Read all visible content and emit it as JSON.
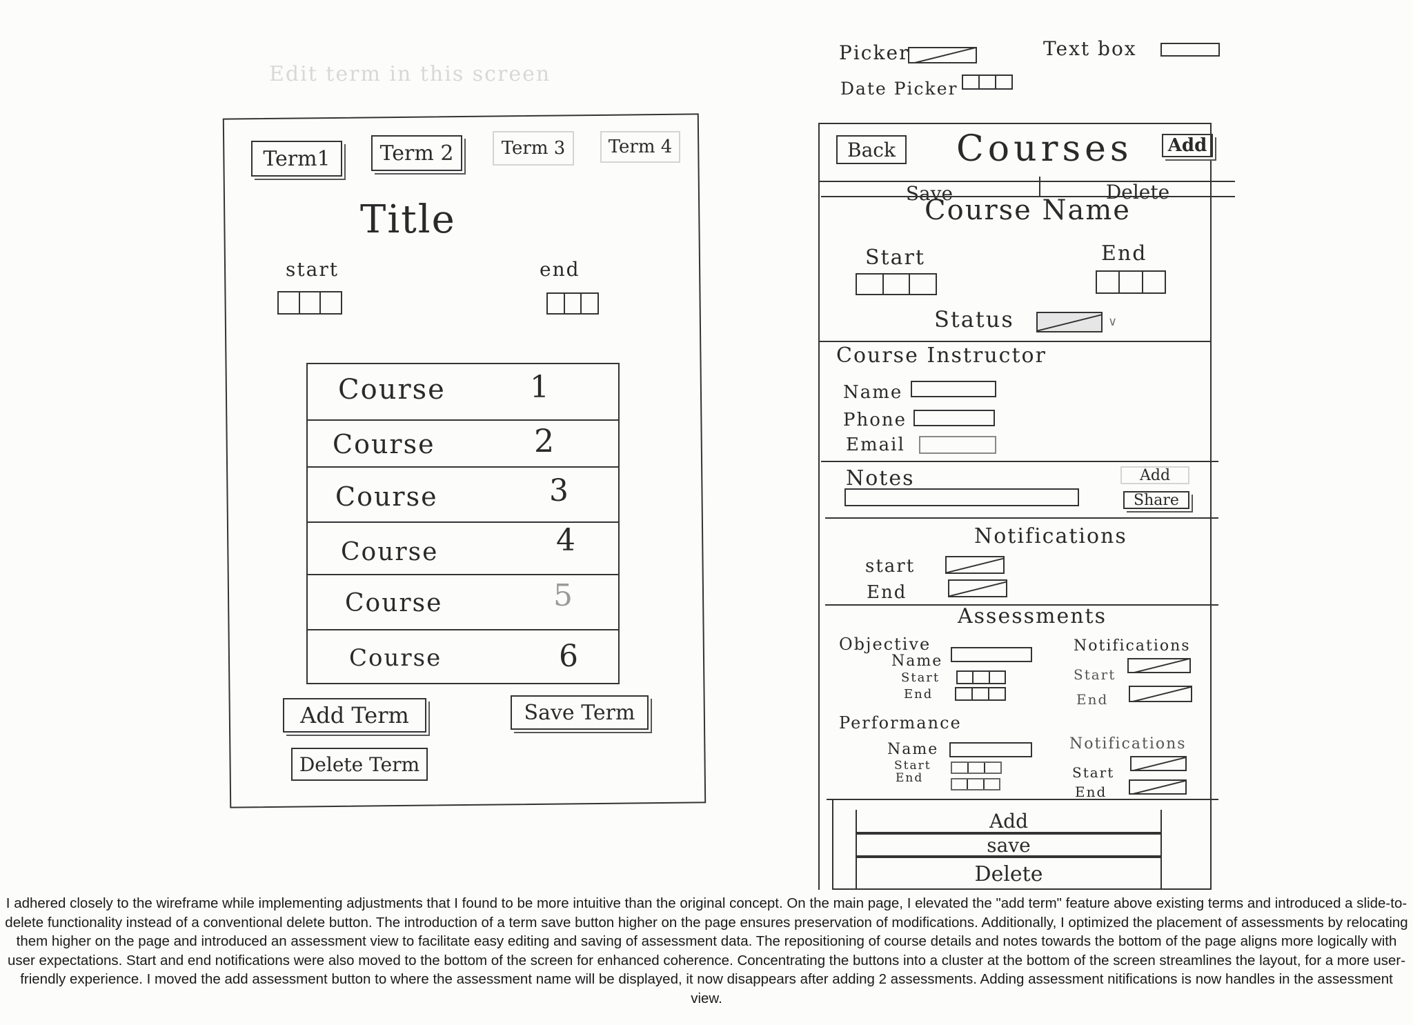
{
  "legend": {
    "picker": "Picker",
    "text_box": "Text box",
    "date_picker": "Date Picker"
  },
  "faint_label": "Edit term in this screen",
  "term_screen": {
    "tabs": [
      "Term1",
      "Term 2",
      "Term 3",
      "Term 4"
    ],
    "title": "Title",
    "start_label": "start",
    "end_label": "end",
    "courses": [
      {
        "label": "Course",
        "num": "1"
      },
      {
        "label": "Course",
        "num": "2"
      },
      {
        "label": "Course",
        "num": "3"
      },
      {
        "label": "Course",
        "num": "4"
      },
      {
        "label": "Course",
        "num": "5"
      },
      {
        "label": "Course",
        "num": "6"
      }
    ],
    "add_term": "Add Term",
    "save_term": "Save Term",
    "delete_term": "Delete Term"
  },
  "course_screen": {
    "back": "Back",
    "title": "Courses",
    "add": "Add",
    "save": "Save",
    "delete": "Delete",
    "course_name": "Course Name",
    "start_label": "Start",
    "end_label": "End",
    "status_label": "Status",
    "instructor_heading": "Course Instructor",
    "name_label": "Name",
    "phone_label": "Phone",
    "email_label": "Email",
    "notes_label": "Notes",
    "notes_add": "Add",
    "notes_share": "Share",
    "notifications_heading": "Notifications",
    "notif_start": "start",
    "notif_end": "End",
    "assessments_heading": "Assessments",
    "objective_label": "Objective",
    "performance_label": "Performance",
    "a_name": "Name",
    "a_start": "Start",
    "a_end": "End",
    "a_notifications": "Notifications",
    "bottom_add": "Add",
    "bottom_save": "save",
    "bottom_delete": "Delete"
  },
  "caption": "I adhered closely to the wireframe while implementing adjustments that I found to be more intuitive than the original concept. On the main page, I elevated the \"add term\" feature above existing terms and introduced a slide-to-delete functionality instead of a conventional delete button. The introduction of a term save button higher on the page ensures preservation of modifications. Additionally, I optimized the placement of assessments by relocating them higher on the page and introduced an assessment view to facilitate easy editing and saving of assessment data. The repositioning of course details and notes towards the bottom of the page aligns more logically with user expectations. Start and end notifications were also moved to the bottom of the screen for enhanced coherence. Concentrating the buttons into a cluster at the bottom of the screen streamlines the layout, for a more user-friendly experience. I moved the add assessment button to where the assessment name will be displayed, it now disappears after adding 2 assessments. Adding assessment nitifications is now handles in the assessment view."
}
